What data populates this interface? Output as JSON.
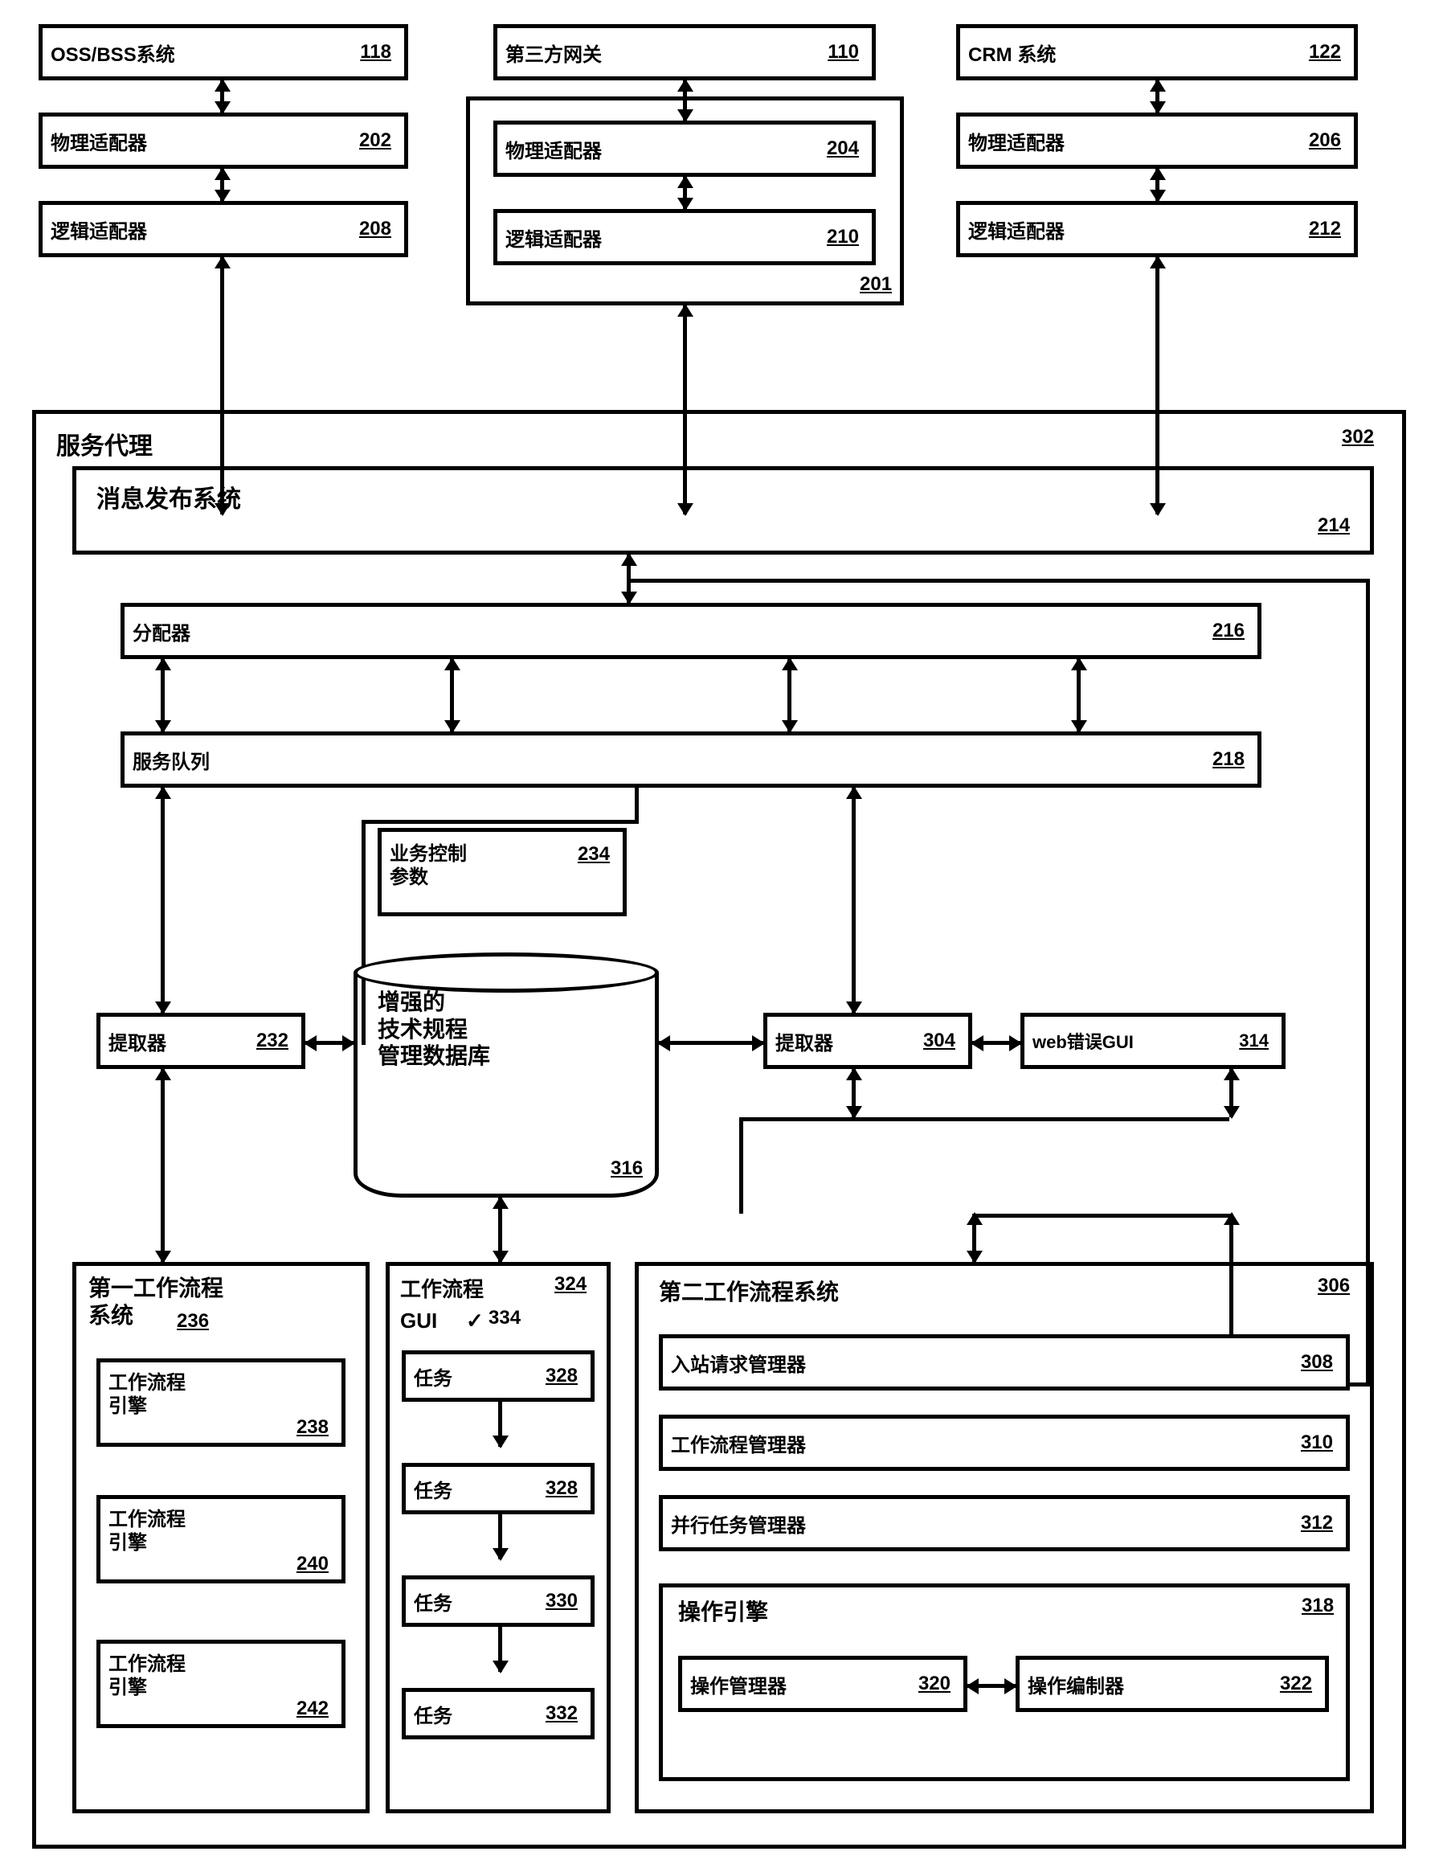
{
  "top": {
    "oss": {
      "label": "OSS/BSS系统",
      "num": "118"
    },
    "phys1": {
      "label": "物理适配器",
      "num": "202"
    },
    "logic1": {
      "label": "逻辑适配器",
      "num": "208"
    },
    "third": {
      "label": "第三方网关",
      "num": "110"
    },
    "phys2": {
      "label": "物理适配器",
      "num": "204"
    },
    "logic2": {
      "label": "逻辑适配器",
      "num": "210"
    },
    "dash_num": "201",
    "crm": {
      "label": "CRM 系统",
      "num": "122"
    },
    "phys3": {
      "label": "物理适配器",
      "num": "206"
    },
    "logic3": {
      "label": "逻辑适配器",
      "num": "212"
    }
  },
  "agent": {
    "title": "服务代理",
    "num": "302",
    "msg": {
      "label": "消息发布系统",
      "num": "214"
    },
    "alloc": {
      "label": "分配器",
      "num": "216"
    },
    "queue": {
      "label": "服务队列",
      "num": "218"
    },
    "bizctrl": {
      "label": "业务控制\n参数",
      "num": "234"
    },
    "extract1": {
      "label": "提取器",
      "num": "232"
    },
    "extract2": {
      "label": "提取器",
      "num": "304"
    },
    "webgui": {
      "label": "web错误GUI",
      "num": "314"
    },
    "db": {
      "label": "增强的\n技术规程\n管理数据库",
      "num": "316"
    }
  },
  "wf1": {
    "title": "第一工作流程\n系统",
    "num": "236",
    "eng1": {
      "label": "工作流程\n引擎",
      "num": "238"
    },
    "eng2": {
      "label": "工作流程\n引擎",
      "num": "240"
    },
    "eng3": {
      "label": "工作流程\n引擎",
      "num": "242"
    }
  },
  "wfgui": {
    "title": "工作流程",
    "num": "324",
    "gui": "GUI",
    "mark_num": "334",
    "t1": {
      "label": "任务",
      "num": "328"
    },
    "t2": {
      "label": "任务",
      "num": "328"
    },
    "t3": {
      "label": "任务",
      "num": "330"
    },
    "t4": {
      "label": "任务",
      "num": "332"
    }
  },
  "wf2": {
    "title": "第二工作流程系统",
    "num": "306",
    "in": {
      "label": "入站请求管理器",
      "num": "308"
    },
    "mgr": {
      "label": "工作流程管理器",
      "num": "310"
    },
    "par": {
      "label": "并行任务管理器",
      "num": "312"
    },
    "op": {
      "title": "操作引擎",
      "num": "318",
      "opmgr": {
        "label": "操作管理器",
        "num": "320"
      },
      "comp": {
        "label": "操作编制器",
        "num": "322"
      }
    }
  }
}
